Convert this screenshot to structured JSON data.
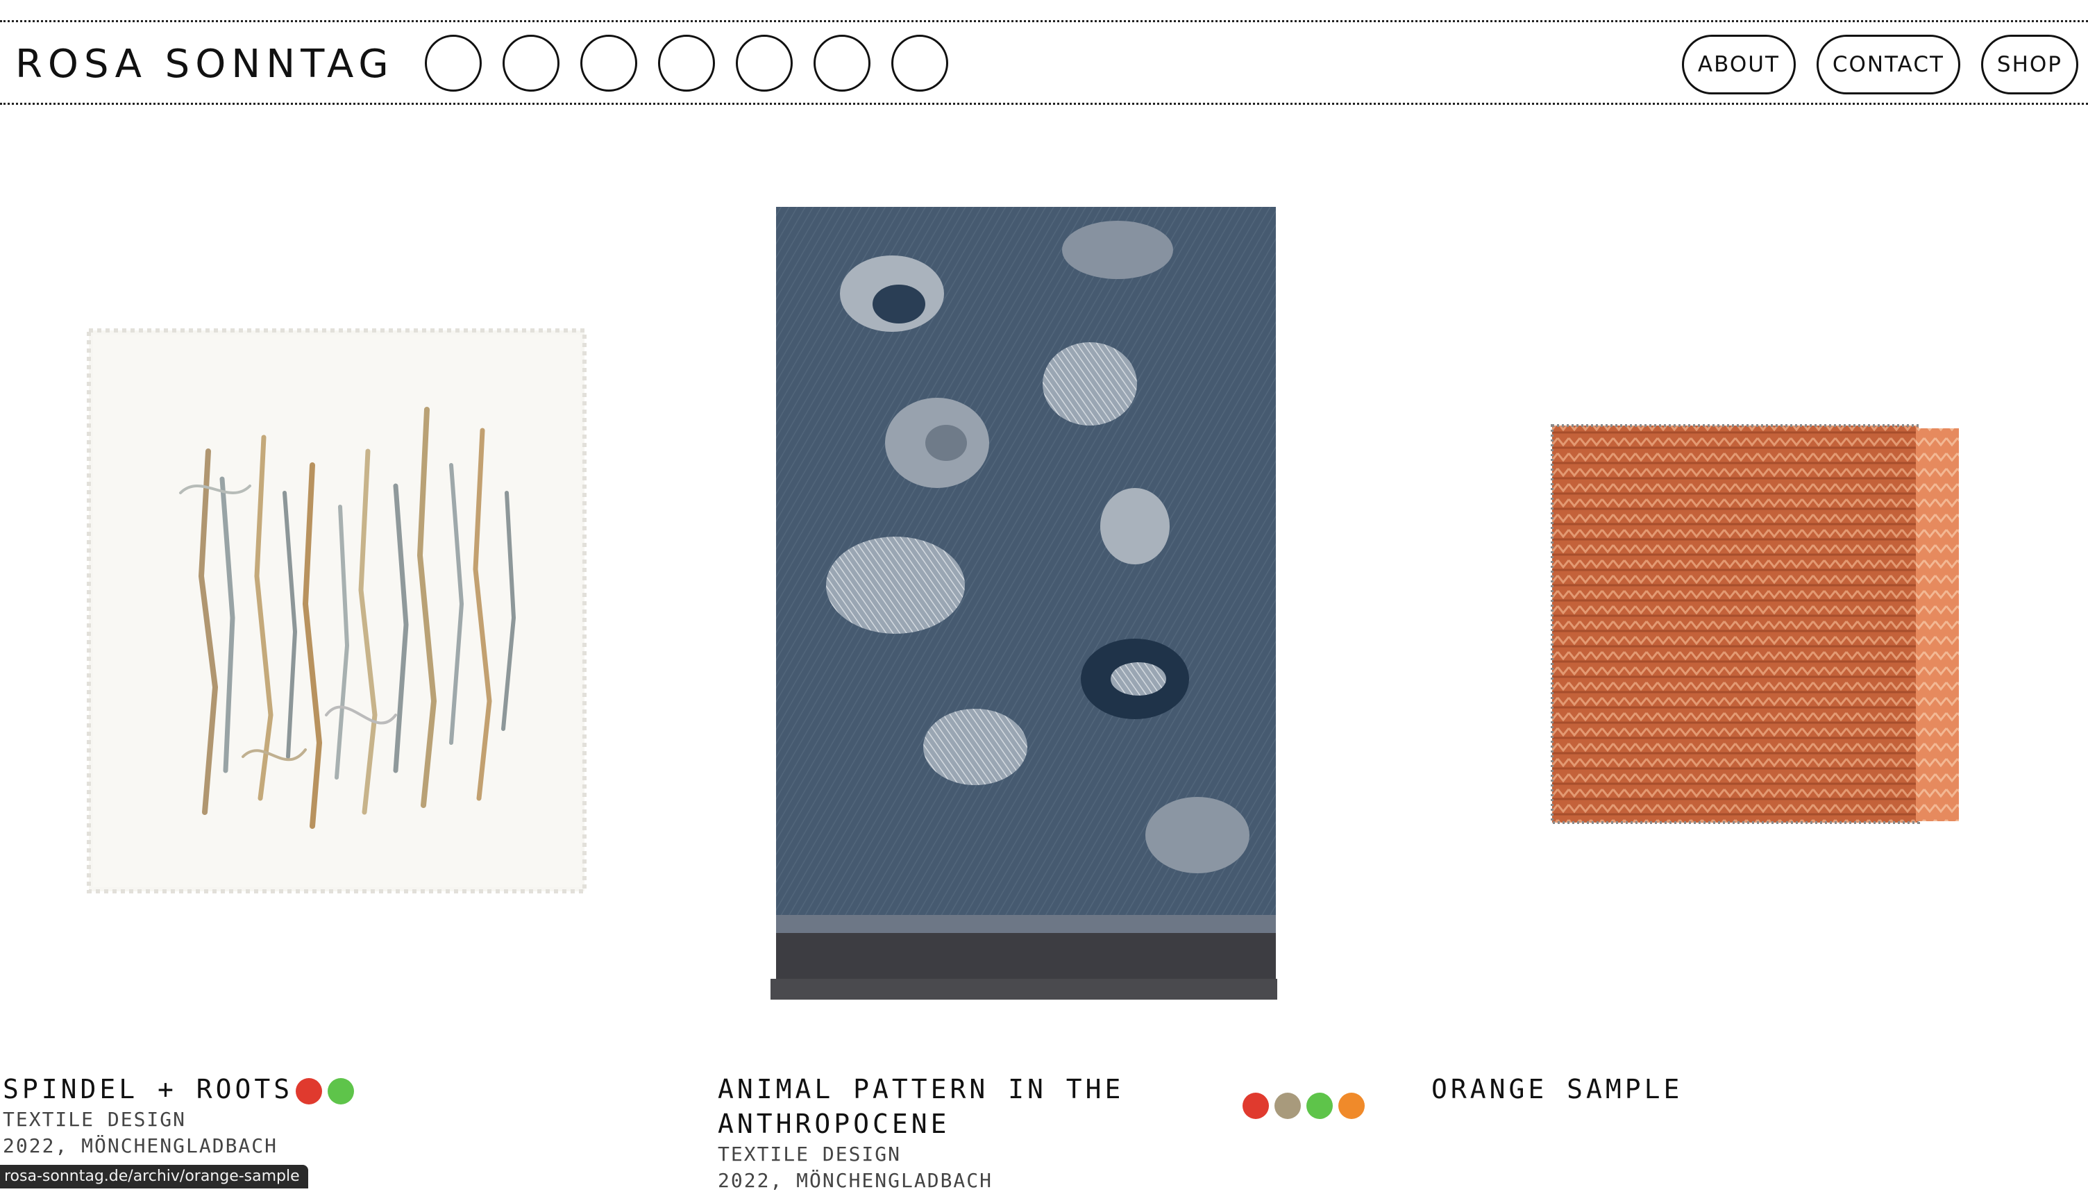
{
  "header": {
    "brand": "ROSA SONNTAG",
    "color_circles": 7,
    "nav": [
      {
        "label": "ABOUT"
      },
      {
        "label": "CONTACT"
      },
      {
        "label": "SHOP"
      }
    ]
  },
  "works": [
    {
      "title": "SPINDEL + ROOTS",
      "category": "TEXTILE DESIGN",
      "meta": "2022, MÖNCHENGLADBACH",
      "color_dots": [
        "#e03a2e",
        "#5ec44a"
      ]
    },
    {
      "title_line1": "ANIMAL PATTERN IN THE",
      "title_line2": "ANTHROPOCENE",
      "category": "TEXTILE DESIGN",
      "meta": "2022, MÖNCHENGLADBACH",
      "color_dots": [
        "#e03a2e",
        "#a89a7c",
        "#5ec44a",
        "#f08a2a"
      ]
    },
    {
      "title": "ORANGE SAMPLE"
    }
  ],
  "statusbar": {
    "url": "rosa-sonntag.de/archiv/orange-sample"
  }
}
